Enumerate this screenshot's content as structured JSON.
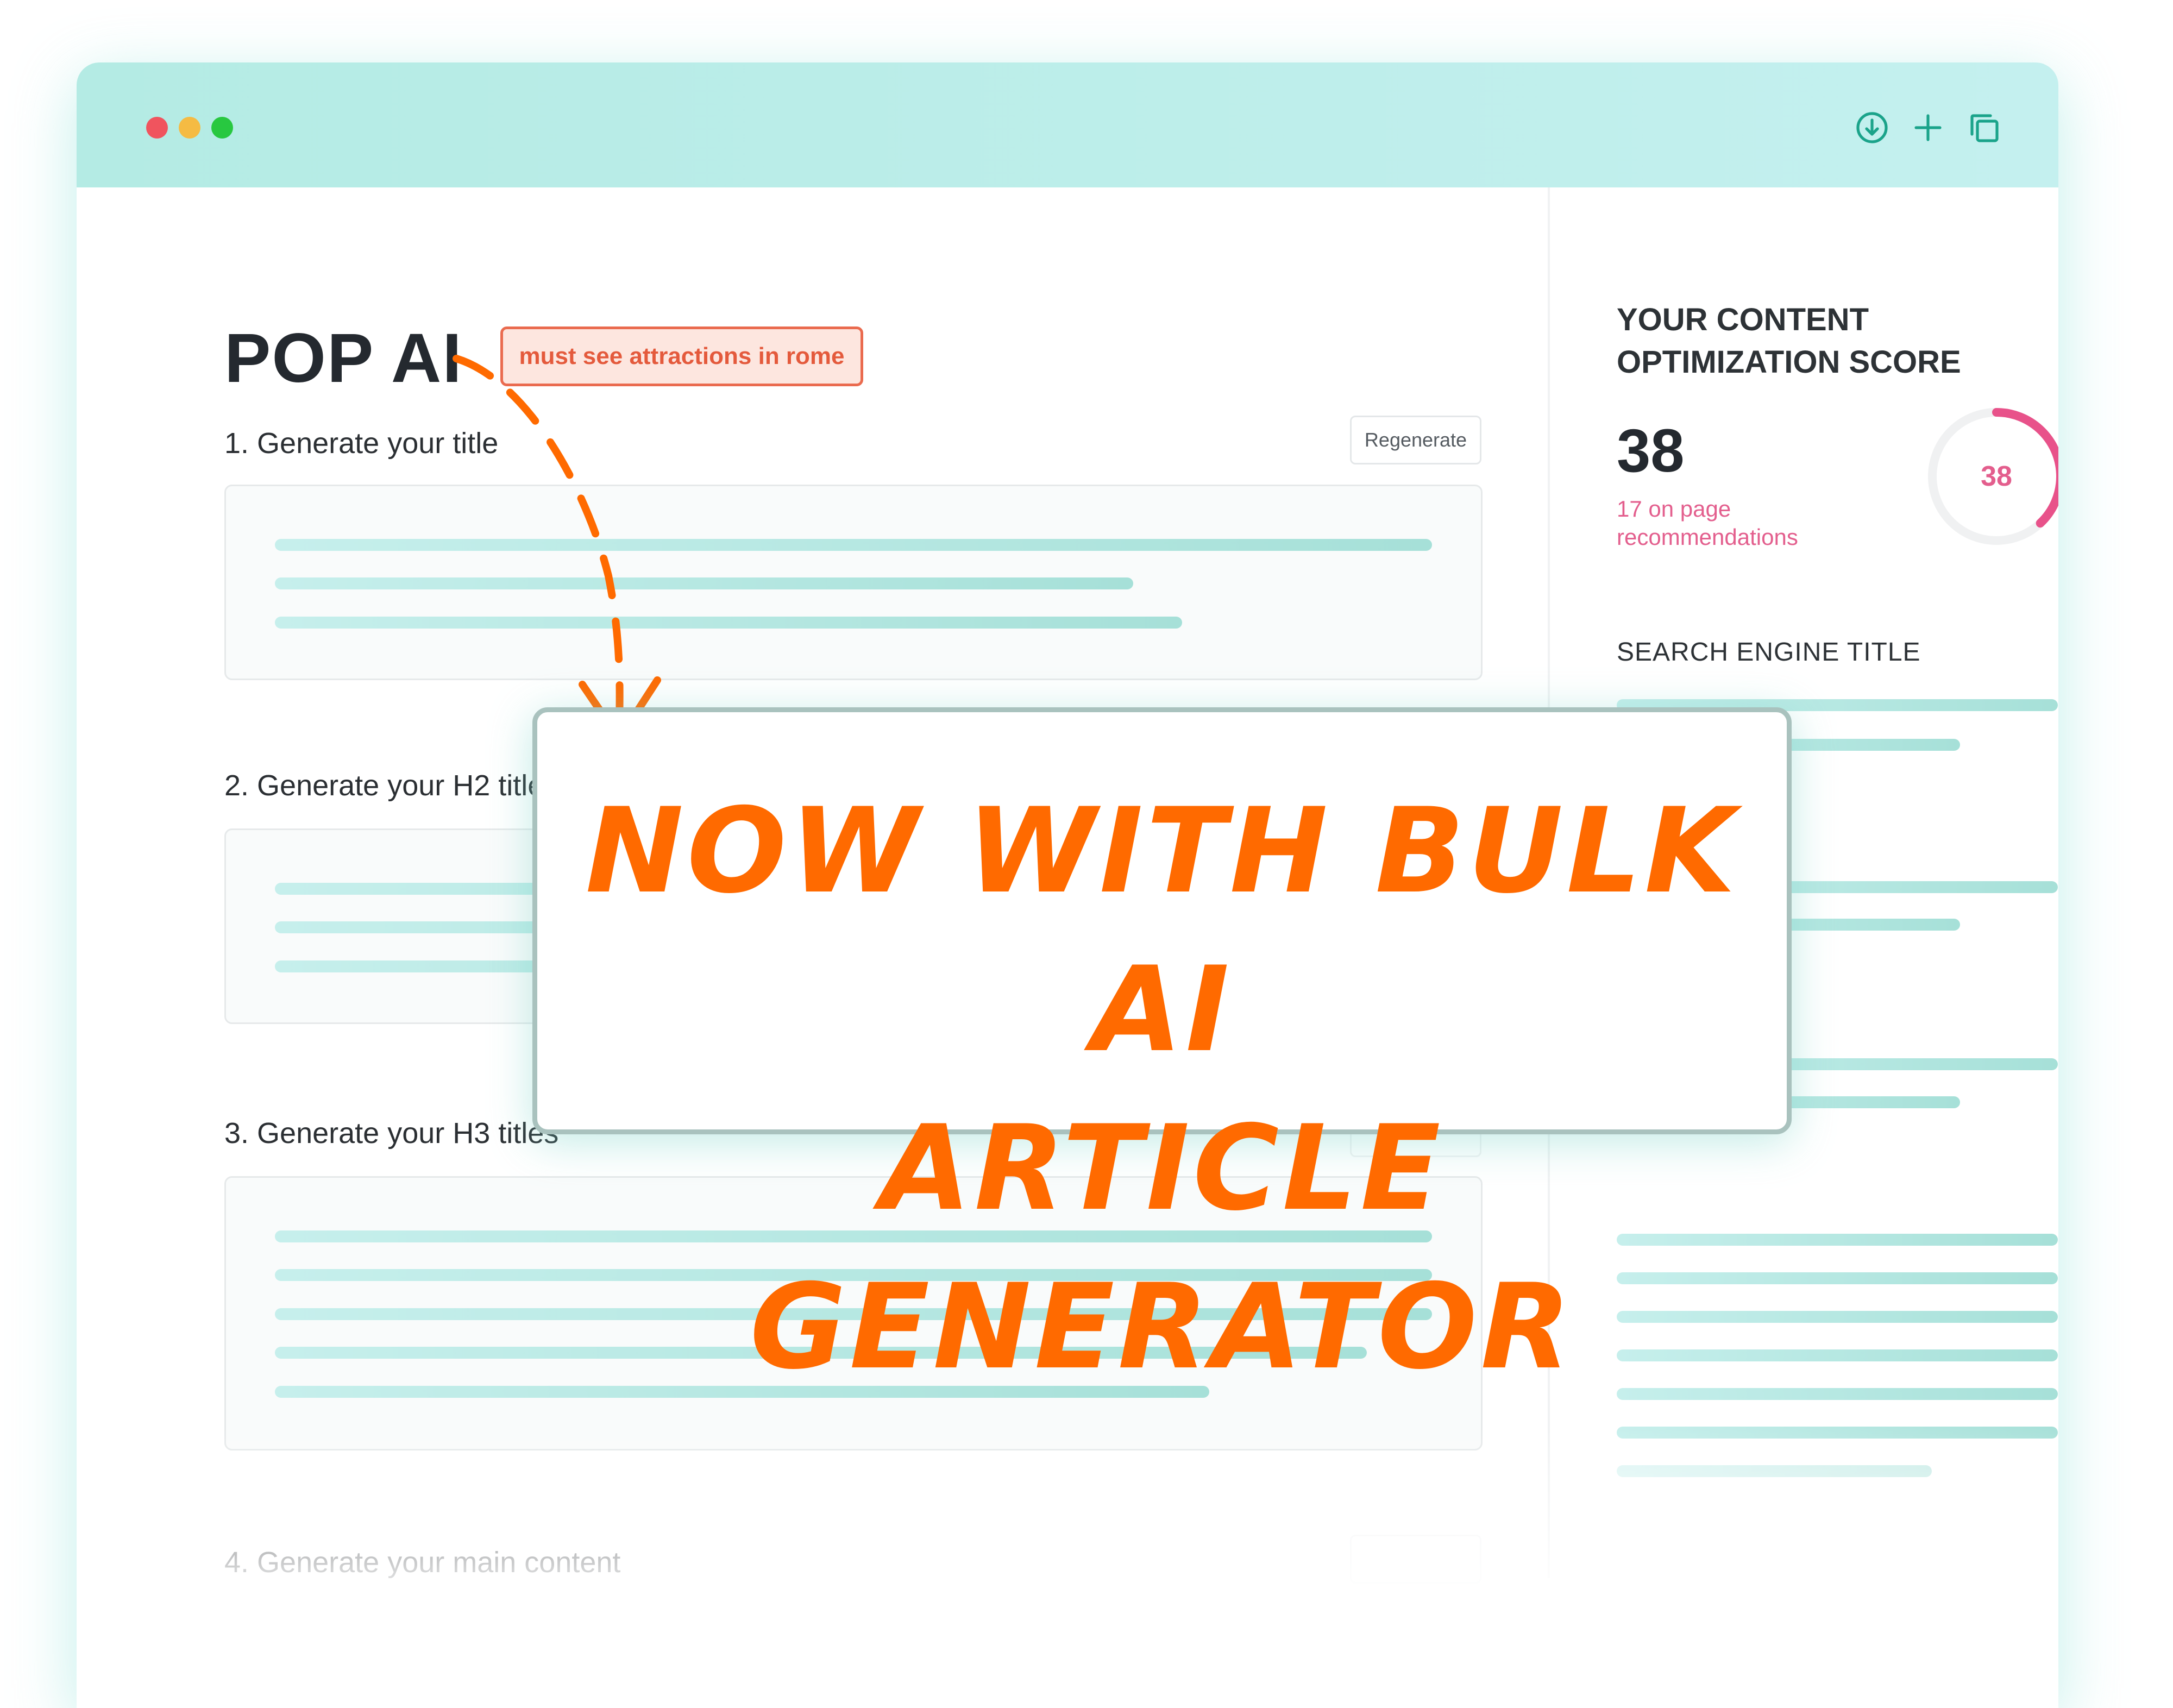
{
  "window": {
    "controls": [
      "close",
      "minimize",
      "maximize"
    ],
    "toolbar_icons": [
      "download-circle-icon",
      "plus-icon",
      "duplicate-icon"
    ]
  },
  "app": {
    "name": "POP AI",
    "keyword": "must see attractions in rome"
  },
  "steps": [
    {
      "label": "1. Generate your title",
      "action": "Regenerate"
    },
    {
      "label": "2. Generate your H2 titles"
    },
    {
      "label": "3. Generate your H3 titles"
    },
    {
      "label": "4. Generate your main content"
    }
  ],
  "score_panel": {
    "heading": "YOUR CONTENT OPTIMIZATION SCORE",
    "score": "38",
    "gauge_value": 38,
    "gauge_max": 100,
    "recommendations": "17 on page recommendations",
    "section_title": "SEARCH ENGINE TITLE"
  },
  "callout": {
    "line1": "NOW WITH BULK AI",
    "line2": "ARTICLE GENERATOR"
  },
  "colors": {
    "accent": "#ff6a00",
    "score": "#e35e8d",
    "titlebar": "#b4ebe4",
    "keyword_border": "#ea6b4f"
  }
}
